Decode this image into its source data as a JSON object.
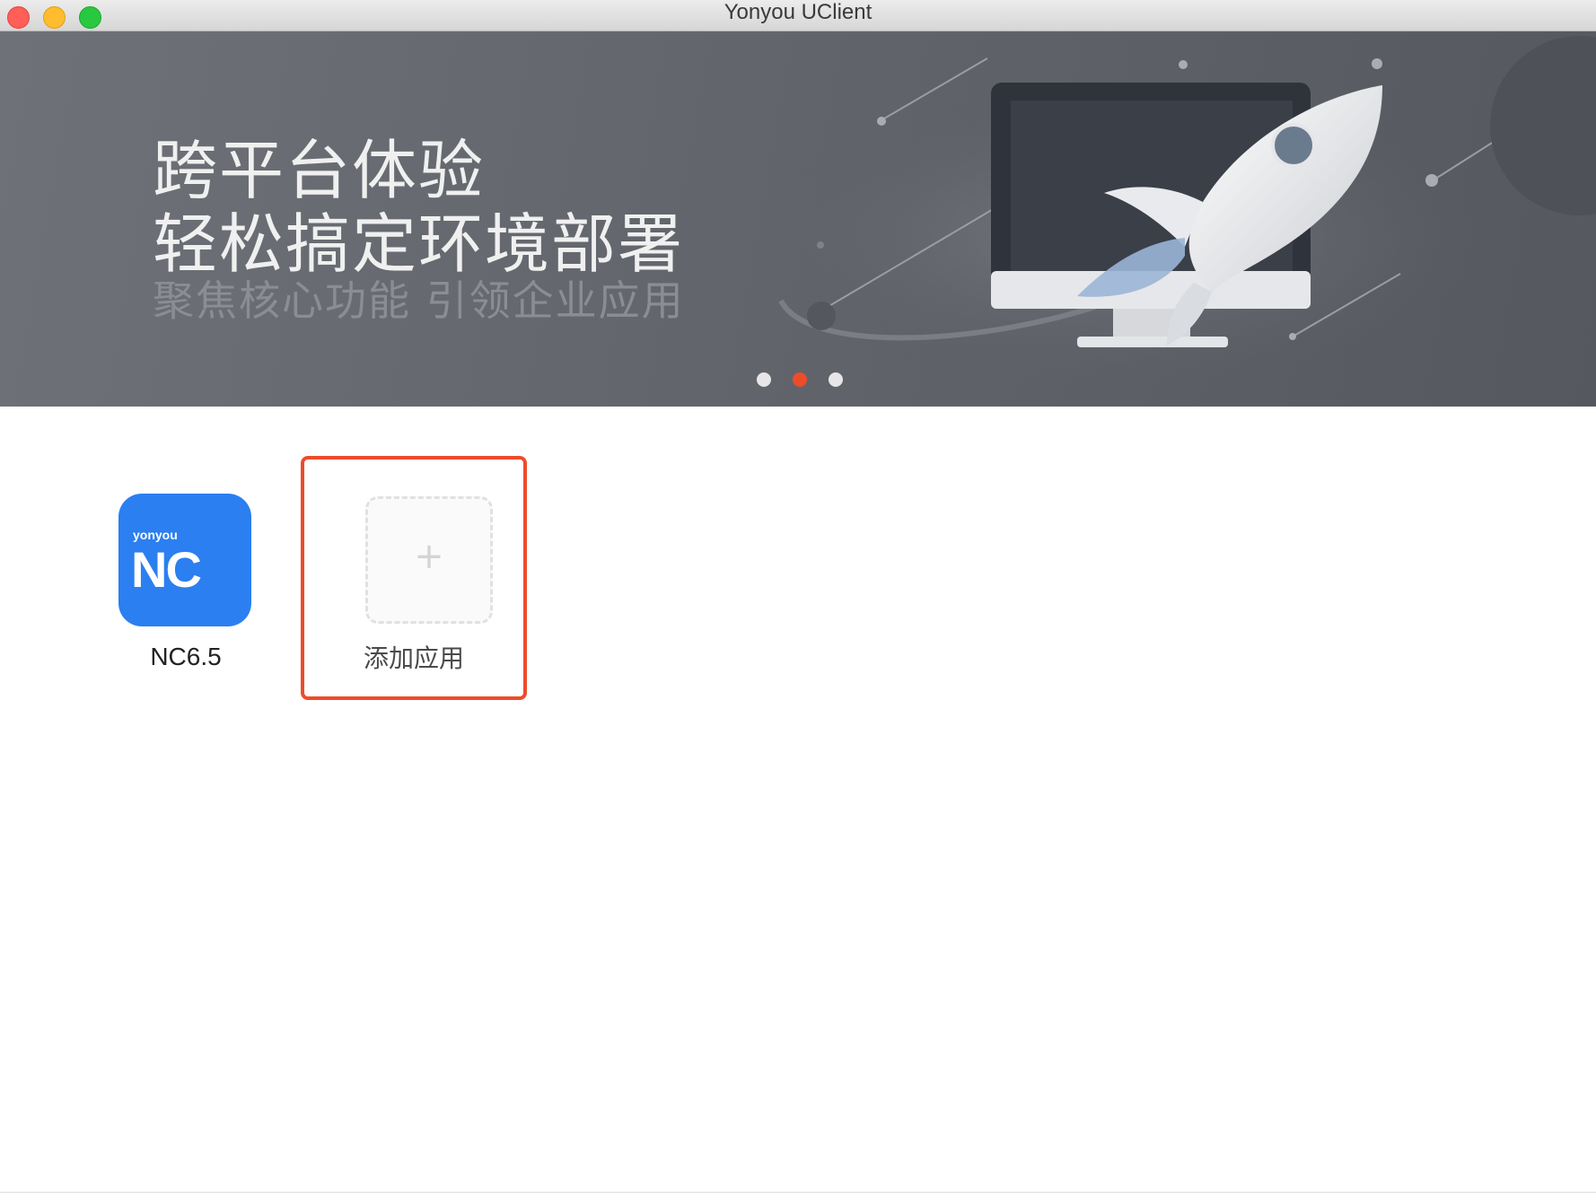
{
  "window": {
    "title": "Yonyou UClient"
  },
  "banner": {
    "line1": "跨平台体验",
    "line2": "轻松搞定环境部署",
    "line3": "聚焦核心功能 引领企业应用",
    "carousel": {
      "count": 3,
      "active_index": 2,
      "active_color": "#ee4b2b"
    }
  },
  "apps": [
    {
      "name": "NC6.5",
      "icon": "yonyou-nc-icon",
      "icon_small_text": "yonyou",
      "icon_big_text": "NC",
      "color": "#2b7ff0"
    }
  ],
  "add_app": {
    "label": "添加应用",
    "icon": "plus-icon",
    "plus": "+"
  },
  "colors": {
    "accent": "#ee4b2b"
  }
}
